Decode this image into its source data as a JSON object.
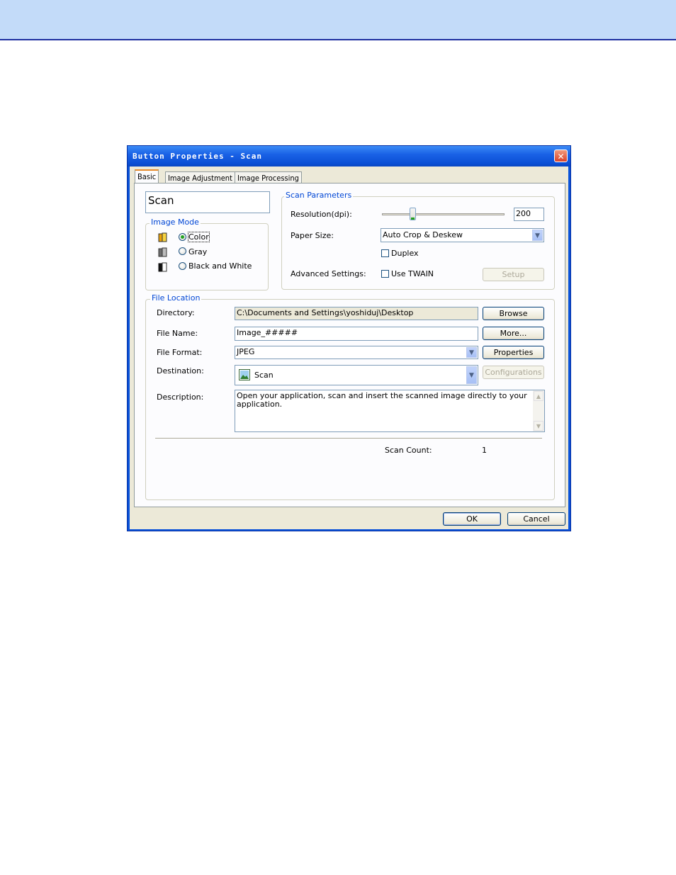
{
  "dialog": {
    "title": "Button Properties - Scan",
    "close_glyph": "✕"
  },
  "tabs": [
    {
      "label": "Basic",
      "active": true
    },
    {
      "label": "Image Adjustment",
      "active": false
    },
    {
      "label": "Image Processing",
      "active": false
    }
  ],
  "button_name": "Scan",
  "image_mode": {
    "legend": "Image Mode",
    "options": [
      {
        "label": "Color",
        "selected": true,
        "icon": "color-document-icon"
      },
      {
        "label": "Gray",
        "selected": false,
        "icon": "gray-document-icon"
      },
      {
        "label": "Black and White",
        "selected": false,
        "icon": "bw-document-icon"
      }
    ]
  },
  "scan_parameters": {
    "legend": "Scan Parameters",
    "resolution_label": "Resolution(dpi):",
    "resolution_value": "200",
    "resolution_slider_fraction": 0.25,
    "paper_size_label": "Paper Size:",
    "paper_size_value": "Auto Crop & Deskew",
    "duplex_label": "Duplex",
    "duplex_checked": false,
    "advanced_label": "Advanced Settings:",
    "use_twain_label": "Use TWAIN",
    "use_twain_checked": false,
    "setup_label": "Setup"
  },
  "file_location": {
    "legend": "File Location",
    "directory_label": "Directory:",
    "directory_value": "C:\\Documents and Settings\\yoshiduj\\Desktop",
    "browse_label": "Browse",
    "file_name_label": "File Name:",
    "file_name_value": "Image_#####",
    "more_label": "More...",
    "file_format_label": "File Format:",
    "file_format_value": "JPEG",
    "properties_label": "Properties",
    "destination_label": "Destination:",
    "destination_value": "Scan",
    "configurations_label": "Configurations",
    "description_label": "Description:",
    "description_value": "Open your application, scan and insert the scanned image directly to your application.",
    "scan_count_label": "Scan Count:",
    "scan_count_value": "1"
  },
  "footer": {
    "ok_label": "OK",
    "cancel_label": "Cancel"
  },
  "colors": {
    "page_band": "#c3dbf9",
    "title_bar": "#0a53d9",
    "legend_text": "#0046d5",
    "window_face": "#ece9d8"
  }
}
